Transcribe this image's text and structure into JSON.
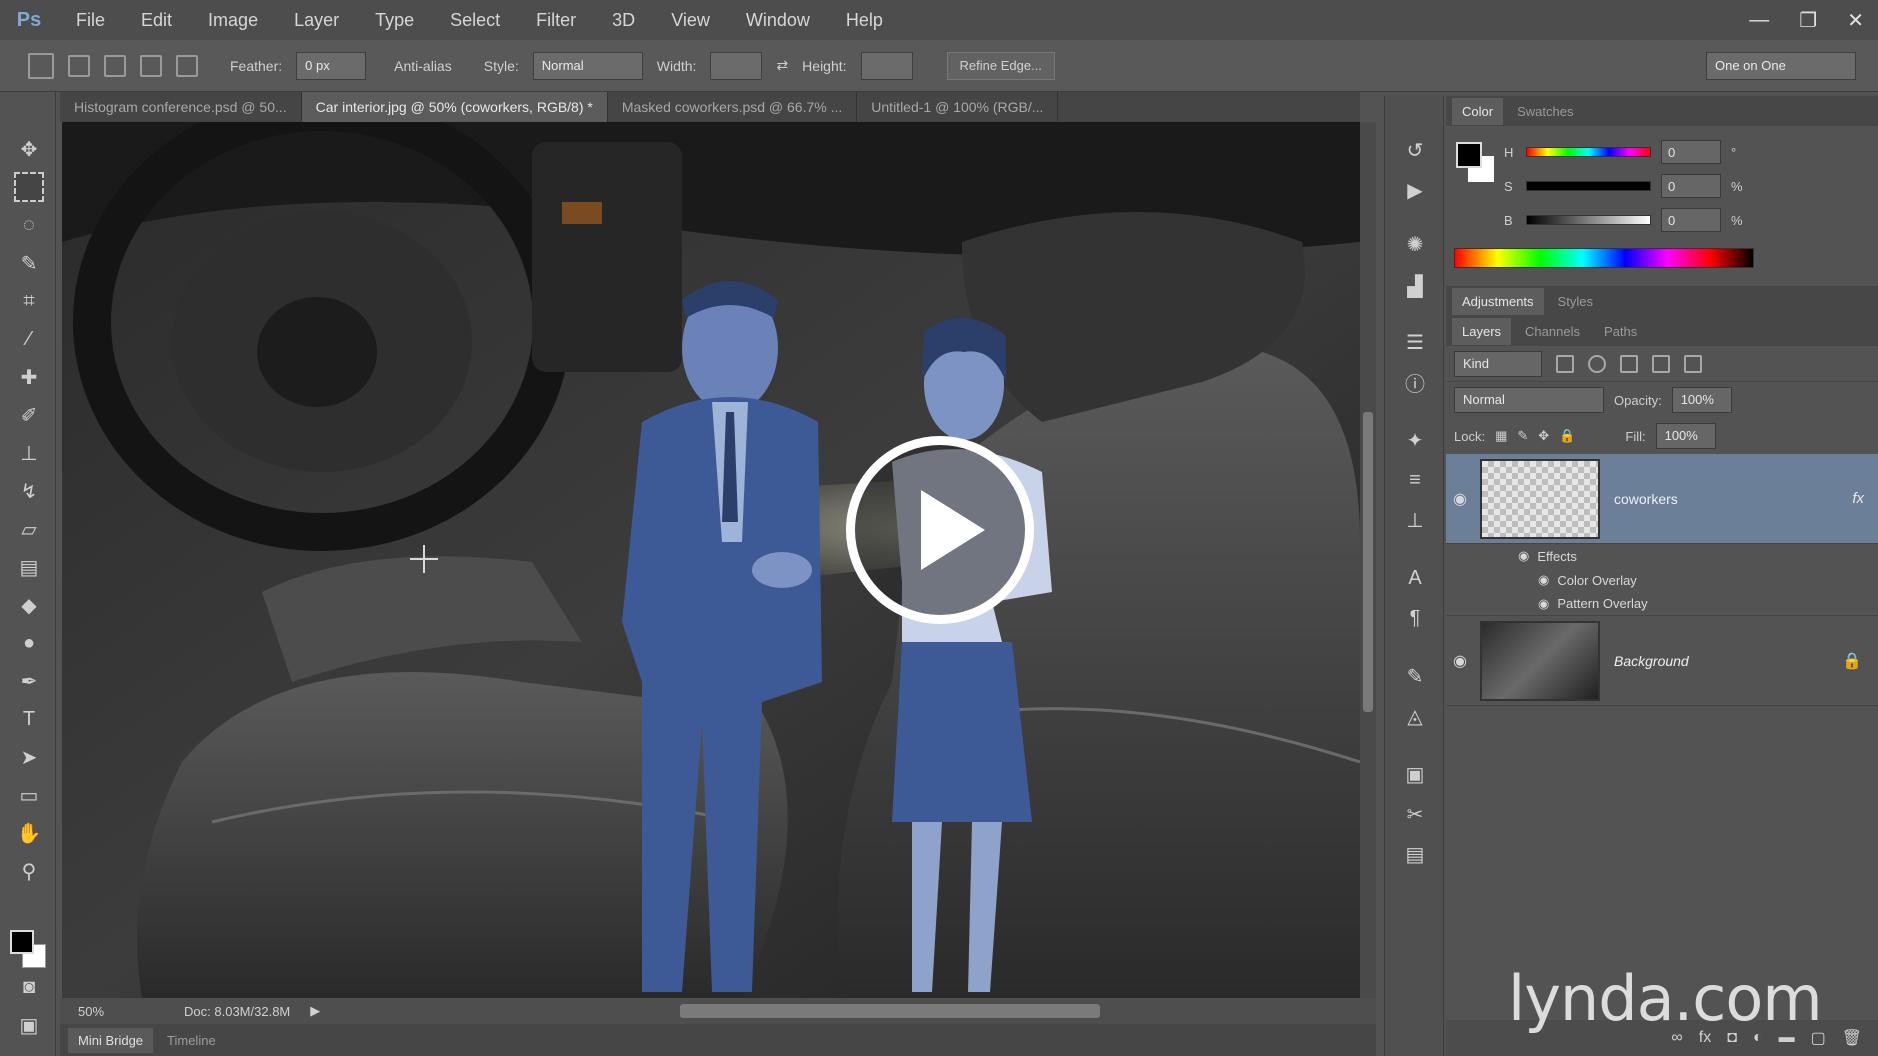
{
  "menu": {
    "logo": "Ps",
    "items": [
      "File",
      "Edit",
      "Image",
      "Layer",
      "Type",
      "Select",
      "Filter",
      "3D",
      "View",
      "Window",
      "Help"
    ],
    "window_controls": [
      "—",
      "❐",
      "✕"
    ]
  },
  "options_bar": {
    "feather_label": "Feather:",
    "feather_value": "0 px",
    "antialias_label": "Anti-alias",
    "style_label": "Style:",
    "style_value": "Normal",
    "width_label": "Width:",
    "height_label": "Height:",
    "refine_edge": "Refine Edge...",
    "workspace": "One on One"
  },
  "doc_tabs": [
    "Histogram conference.psd @ 50...",
    "Car interior.jpg @ 50% (coworkers, RGB/8) *",
    "Masked coworkers.psd @ 66.7% ...",
    "Untitled-1 @ 100% (RGB/..."
  ],
  "status": {
    "zoom": "50%",
    "doc_size": "Doc: 8.03M/32.8M"
  },
  "bottom_tabs": [
    "Mini Bridge",
    "Timeline"
  ],
  "color_panel": {
    "tabs": [
      "Color",
      "Swatches"
    ],
    "sliders": [
      {
        "label": "H",
        "value": "0",
        "unit": "°"
      },
      {
        "label": "S",
        "value": "0",
        "unit": "%"
      },
      {
        "label": "B",
        "value": "0",
        "unit": "%"
      }
    ]
  },
  "adjust_tabs": [
    "Adjustments",
    "Styles"
  ],
  "layers_panel": {
    "tabs": [
      "Layers",
      "Channels",
      "Paths"
    ],
    "kind_filter": "Kind",
    "blend_mode": "Normal",
    "opacity_label": "Opacity:",
    "opacity_value": "100%",
    "lock_label": "Lock:",
    "fill_label": "Fill:",
    "fill_value": "100%",
    "layers": [
      {
        "name": "coworkers",
        "fx": "fx",
        "selected": true
      },
      {
        "name": "Background",
        "locked": true,
        "selected": false
      }
    ],
    "effects_label": "Effects",
    "effects": [
      "Color Overlay",
      "Pattern Overlay"
    ]
  },
  "watermark": "lynda.com",
  "colors": {
    "accent_selected_layer": "#6b7f98",
    "suit_tint": "#3d5a96",
    "ui_dark": "#535353"
  }
}
